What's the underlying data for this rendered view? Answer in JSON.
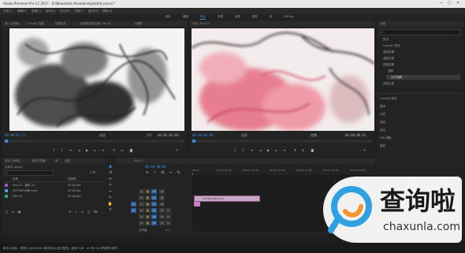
{
  "window": {
    "title": "Adobe Premiere Pro CC 2017 - D:\\Bloodstain.Resadesing\\未命名.prproj *",
    "controls": [
      "—",
      "□",
      "✕"
    ]
  },
  "menu": [
    "文件(F)",
    "编辑(E)",
    "剪辑(C)",
    "序列(S)",
    "标记(M)",
    "字幕(T)",
    "窗口(W)",
    "帮助(H)"
  ],
  "workspaces": [
    {
      "label": "组件",
      "active": false
    },
    {
      "label": "编辑",
      "active": false
    },
    {
      "label": "颜色",
      "active": true
    },
    {
      "label": "效果",
      "active": false
    },
    {
      "label": "音频",
      "active": false
    },
    {
      "label": "图形",
      "active": false
    },
    {
      "label": "库",
      "active": false
    },
    {
      "label": "Editing",
      "active": false
    }
  ],
  "source_monitor": {
    "tabs": [
      "源: (无剪辑)",
      "Lumetri 范围",
      "效果控件",
      "音频剪辑混合器: Seq 01",
      "元数据"
    ],
    "timecode_in": "00:00:01:21",
    "zoom": "适合",
    "scale": "1/2",
    "timecode_out": "00:00:03:00"
  },
  "program_monitor": {
    "tab": "节目: Seq 01",
    "timecode_in": "00:00:00:00",
    "zoom": "适合",
    "scale": "完整",
    "timecode_out": "00:00:06:01"
  },
  "right_panel": {
    "header": "效果",
    "search_placeholder": "",
    "items": [
      "预设",
      "Lumetri 预设",
      "音频效果",
      "音频过渡",
      "视频效果",
      "视频过渡"
    ],
    "sub_items": [
      "溶解",
      "交叉溶解"
    ],
    "sections": [
      "Lumetri 颜色",
      "基本",
      "创意",
      "曲线",
      "色轮",
      "HSL 辅助",
      "晕影"
    ]
  },
  "project": {
    "tabs": [
      "项目: 未命名",
      "媒体浏览器",
      "库",
      "信息"
    ],
    "file": "未命名.prproj",
    "count": "3 项",
    "headers": [
      "名称",
      "帧速率"
    ],
    "rows": [
      {
        "name": "Seq 01 - 副本 01",
        "fps": "25.00 fps",
        "color": "#9b59b6"
      },
      {
        "name": "9073459486.mp4",
        "fps": "25.00 fps",
        "color": "#4aa3df"
      },
      {
        "name": "Seq 01",
        "fps": "25.00 fps",
        "color": "#27ae60"
      }
    ]
  },
  "timeline": {
    "tab": "Seq 01",
    "timecode": "00:00:00:00",
    "ruler": [
      "00:00",
      "00:00:05:00",
      "00:00:10:00",
      "00:00:15:00",
      "00:00:20:00",
      "00:00:25:00",
      "00:00:30:00"
    ],
    "tracks": [
      "V3",
      "V2",
      "V1",
      "A1",
      "A2",
      "A3"
    ],
    "clip_label": "9073459486.mp4",
    "master": "主声道",
    "master_value": "0.0"
  },
  "status_bar": "单击以选择，或按住 Alt/Option 键并拖动以进行框选。使用 Shift、Alt 和 Ctrl 获取更多选项。",
  "watermark": {
    "text": "查询啦",
    "url": "chaxunla.com"
  }
}
